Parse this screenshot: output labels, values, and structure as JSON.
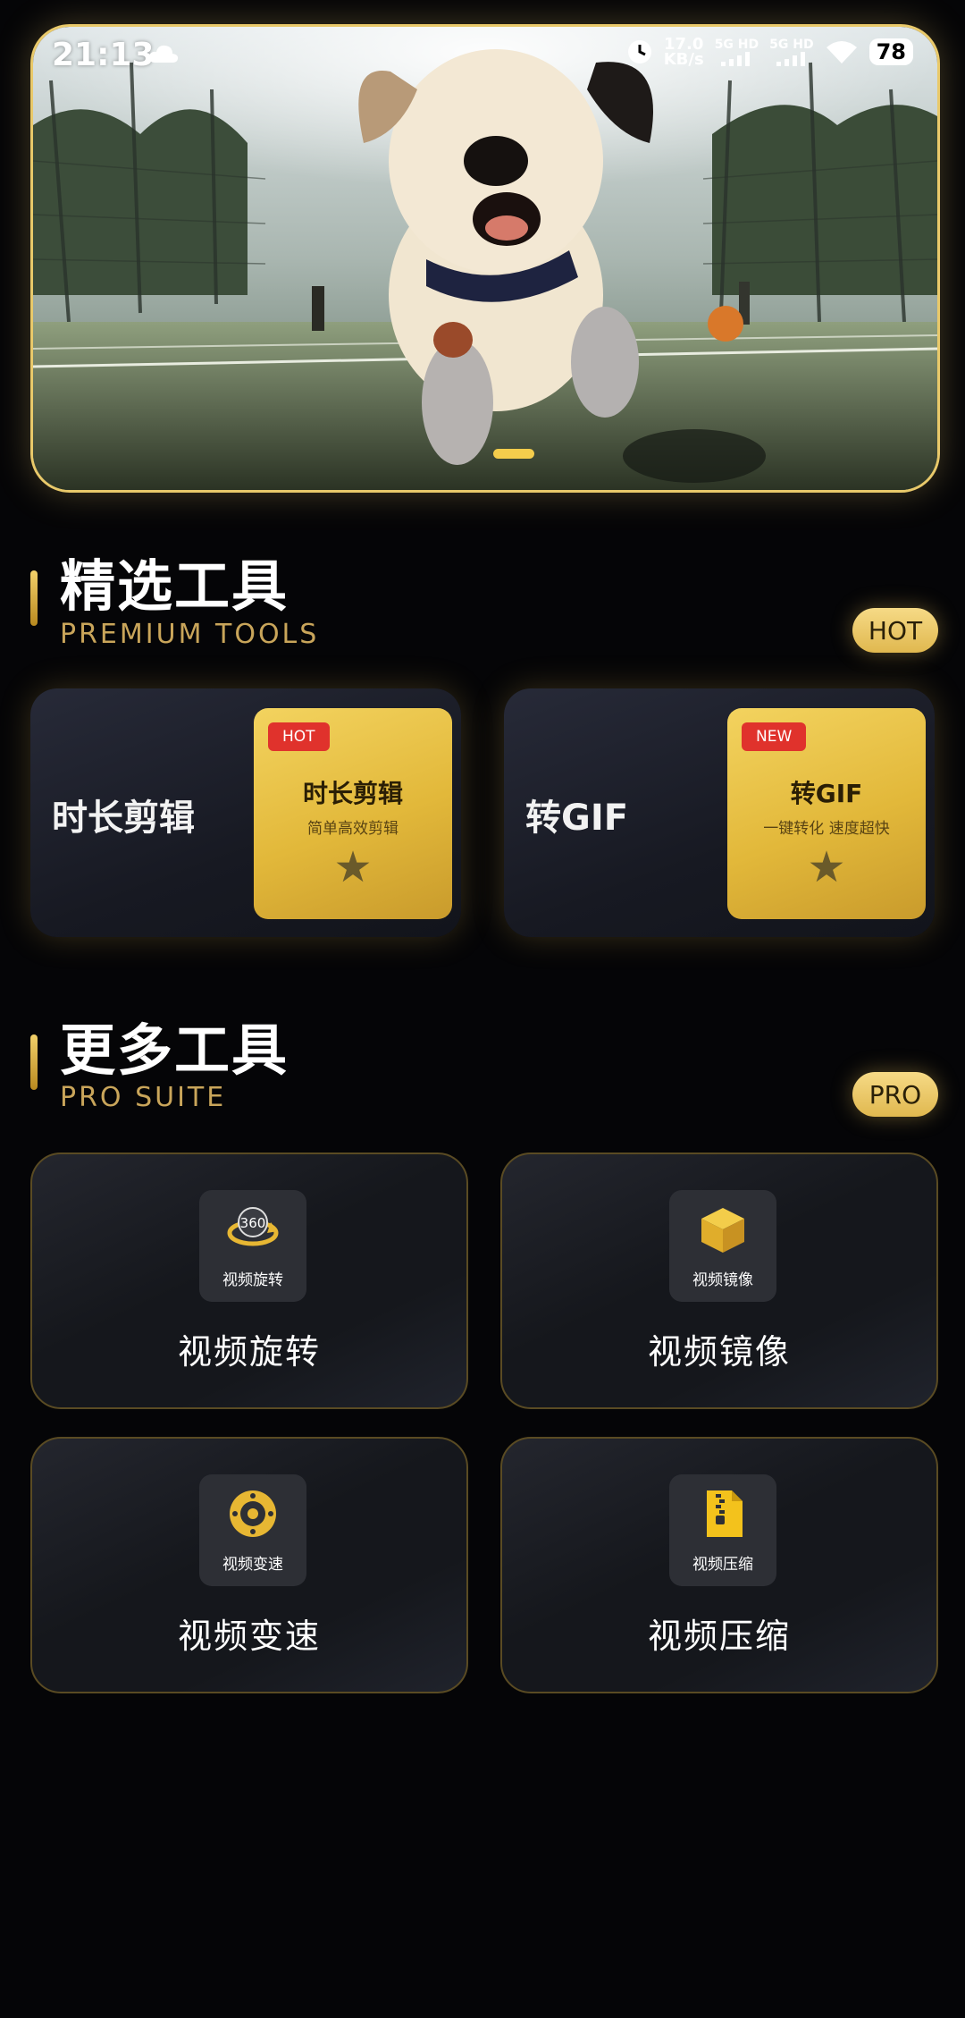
{
  "status_bar": {
    "time": "21:13",
    "net_speed_value": "17.0",
    "net_speed_unit": "KB/s",
    "sim1": "5G HD",
    "sim2": "5G HD",
    "battery": "78"
  },
  "banner": {
    "image": "dog-running-on-tennis-court"
  },
  "premium": {
    "title": "精选工具",
    "subtitle": "PREMIUM TOOLS",
    "badge": "HOT",
    "cards": [
      {
        "label": "时长剪辑",
        "thumb_badge": "HOT",
        "thumb_title": "时长剪辑",
        "thumb_subtitle": "简单高效剪辑",
        "thumb_star": "★"
      },
      {
        "label": "转GIF",
        "thumb_badge": "NEW",
        "thumb_title": "转GIF",
        "thumb_subtitle": "一键转化 速度超快",
        "thumb_star": "★"
      }
    ]
  },
  "more": {
    "title": "更多工具",
    "subtitle": "PRO SUITE",
    "badge": "PRO",
    "tools": [
      {
        "icon": "rotate-360-icon",
        "icon_label": "视频旋转",
        "label": "视频旋转"
      },
      {
        "icon": "cube-mirror-icon",
        "icon_label": "视频镜像",
        "label": "视频镜像"
      },
      {
        "icon": "speedometer-icon",
        "icon_label": "视频变速",
        "label": "视频变速"
      },
      {
        "icon": "zip-file-icon",
        "icon_label": "视频压缩",
        "label": "视频压缩"
      }
    ]
  },
  "colors": {
    "accent_gold": "#e9c96a",
    "badge_red": "#e0322c",
    "background": "#050507"
  }
}
